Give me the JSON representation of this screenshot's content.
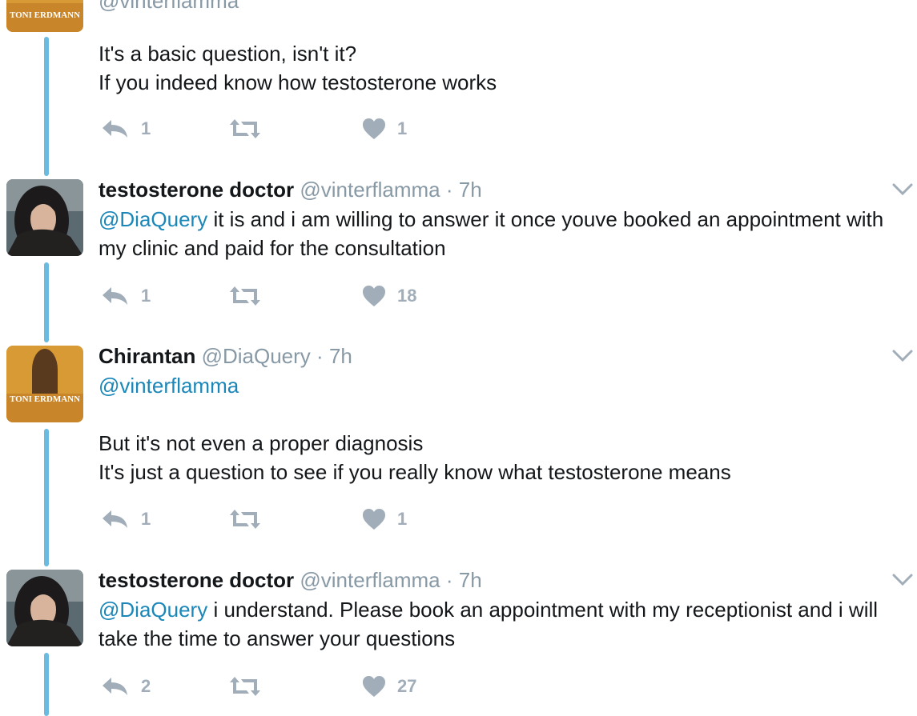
{
  "colors": {
    "thread_line": "#6bbbe0",
    "mention": "#1b87b8",
    "secondary": "#8899a6",
    "action_icon": "#a1adb8"
  },
  "tweets": [
    {
      "author": "",
      "handle": "@vinterflamma",
      "time": "",
      "avatar": "toni-erdmann-poster",
      "avatar_text": "TONI ERDMANN",
      "lines": [
        "It's a basic question, isn't it?",
        "If you indeed know how testosterone works"
      ],
      "replies": "1",
      "retweets": "",
      "likes": "1"
    },
    {
      "author": "testosterone doctor",
      "handle": "@vinterflamma",
      "dot": "·",
      "time": "7h",
      "avatar": "dark-haired-woman-photo",
      "mention": "@DiaQuery",
      "text": " it is and i am willing to answer it once youve booked an appointment with my clinic and paid for the consultation",
      "replies": "1",
      "retweets": "",
      "likes": "18"
    },
    {
      "author": "Chirantan",
      "handle": "@DiaQuery",
      "dot": "·",
      "time": "7h",
      "avatar": "toni-erdmann-poster",
      "avatar_text": "TONI ERDMANN",
      "mention": "@vinterflamma",
      "lines": [
        "But it's not even a proper diagnosis",
        "It's just a question to see if you really know what testosterone means"
      ],
      "replies": "1",
      "retweets": "",
      "likes": "1"
    },
    {
      "author": "testosterone doctor",
      "handle": "@vinterflamma",
      "dot": "·",
      "time": "7h",
      "avatar": "dark-haired-woman-photo",
      "mention": "@DiaQuery",
      "text": " i understand. Please book an appointment with my receptionist and i will take the time to answer your questions",
      "replies": "2",
      "retweets": "",
      "likes": "27"
    }
  ]
}
